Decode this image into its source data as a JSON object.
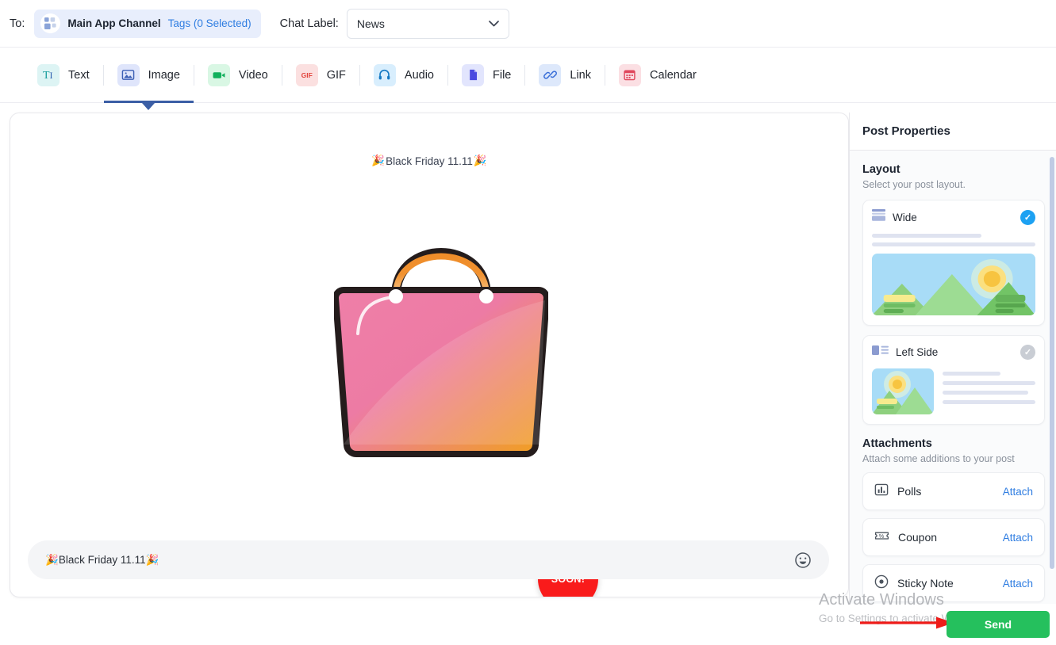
{
  "topbar": {
    "to_label": "To:",
    "recipient": {
      "name": "Main App Channel",
      "tags": "Tags (0 Selected)",
      "icon": "grid-icon"
    },
    "chat_label_text": "Chat Label:",
    "chat_label_value": "News",
    "chat_label_options": [
      "News"
    ],
    "chevron": "∨"
  },
  "tabs": [
    {
      "label": "Text",
      "icon": "text-icon",
      "active": false
    },
    {
      "label": "Image",
      "icon": "image-icon",
      "active": true
    },
    {
      "label": "Video",
      "icon": "video-icon",
      "active": false
    },
    {
      "label": "GIF",
      "icon": "gif-icon",
      "active": false
    },
    {
      "label": "Audio",
      "icon": "audio-icon",
      "active": false
    },
    {
      "label": "File",
      "icon": "file-icon",
      "active": false
    },
    {
      "label": "Link",
      "icon": "link-icon",
      "active": false
    },
    {
      "label": "Calendar",
      "icon": "calendar-icon",
      "active": false
    }
  ],
  "canvas": {
    "post_title_emoji_left": "🎉",
    "post_title": "Black Friday 11.11",
    "post_title_emoji_right": "🎉",
    "image_alt": "shopping-bag-illustration",
    "badge_text": "SOON!",
    "badge_close": "×",
    "caption_emoji_left": "🎉",
    "caption_text": "Black Friday 11.11",
    "caption_emoji_right": "🎉",
    "emoji_button": "☺"
  },
  "properties": {
    "title": "Post Properties",
    "layout_section": {
      "title": "Layout",
      "subtitle": "Select your post layout."
    },
    "layouts": [
      {
        "name": "Wide",
        "selected": true,
        "check": "✓"
      },
      {
        "name": "Left Side",
        "selected": false,
        "check": "✓"
      }
    ],
    "attachments_section": {
      "title": "Attachments",
      "subtitle": "Attach some additions to your post"
    },
    "attachments": [
      {
        "name": "Polls",
        "action": "Attach",
        "icon": "bar-chart-icon"
      },
      {
        "name": "Coupon",
        "action": "Attach",
        "icon": "coupon-icon"
      },
      {
        "name": "Sticky Note",
        "action": "Attach",
        "icon": "sticky-note-icon"
      }
    ]
  },
  "footer": {
    "send_label": "Send",
    "watermark_line1": "Activate Windows",
    "watermark_line2": "Go to Settings to activate Windows."
  },
  "colors": {
    "accent_blue": "#2f7de1",
    "active_tab_underline": "#3b5ea5",
    "send_green": "#25c05d",
    "badge_red": "#f91b1b",
    "check_blue": "#1da1f2",
    "arrow_red": "#ee1c19"
  }
}
